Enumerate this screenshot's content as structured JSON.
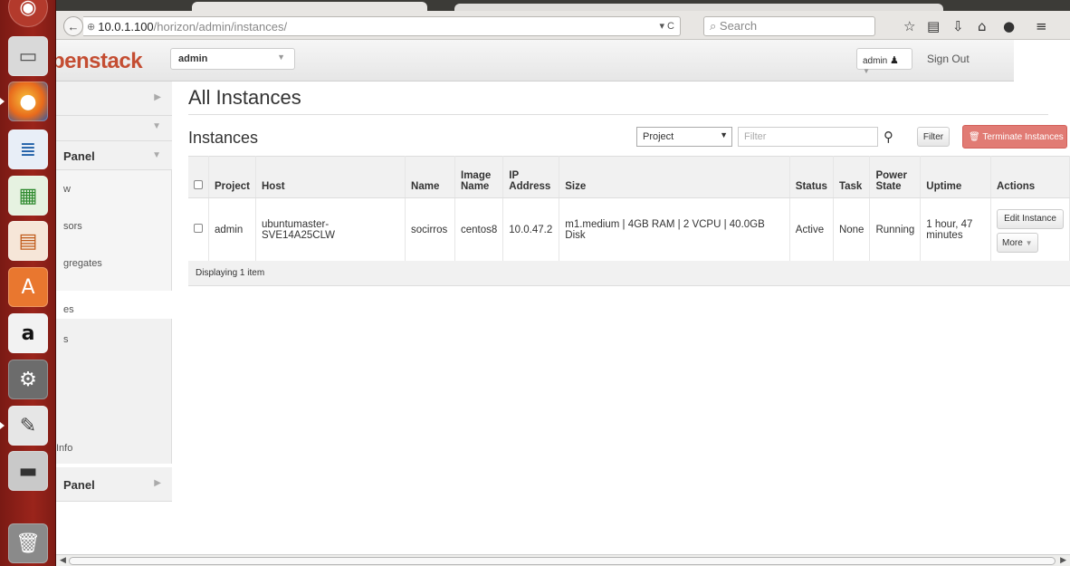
{
  "browser": {
    "url_host": "10.0.1.100",
    "url_path": "/horizon/admin/instances/",
    "search_placeholder": "Search"
  },
  "header": {
    "logo_left": "penstack",
    "project_selector": "admin",
    "user_menu": "admin",
    "sign_out": "Sign Out"
  },
  "sidebar": {
    "panel_admin": "Panel",
    "item_1": "w",
    "item_2": "sors",
    "item_3": "gregates",
    "item_4": "es",
    "item_5": "s",
    "item_info": "Info",
    "panel_identity": "Panel"
  },
  "main": {
    "page_title": "All Instances",
    "table_title": "Instances",
    "filter_field": "Project",
    "filter_placeholder": "Filter",
    "filter_button": "Filter",
    "terminate_button": "Terminate Instances",
    "columns": {
      "project": "Project",
      "host": "Host",
      "name": "Name",
      "image_name": "Image Name",
      "ip_address": "IP Address",
      "size": "Size",
      "status": "Status",
      "task": "Task",
      "power_state": "Power State",
      "uptime": "Uptime",
      "actions": "Actions"
    },
    "rows": [
      {
        "project": "admin",
        "host": "ubuntumaster-SVE14A25CLW",
        "name": "socirros",
        "image_name": "centos8",
        "ip_address": "10.0.47.2",
        "size": "m1.medium | 4GB RAM | 2 VCPU | 40.0GB Disk",
        "status": "Active",
        "task": "None",
        "power_state": "Running",
        "uptime": "1 hour, 47 minutes",
        "edit_button": "Edit Instance",
        "more_button": "More"
      }
    ],
    "footer": "Displaying 1 item"
  },
  "colors": {
    "launcher": "#9b241b",
    "brand": "#c44d32",
    "link": "#2a8bd0",
    "danger_button": "#e17b74"
  }
}
